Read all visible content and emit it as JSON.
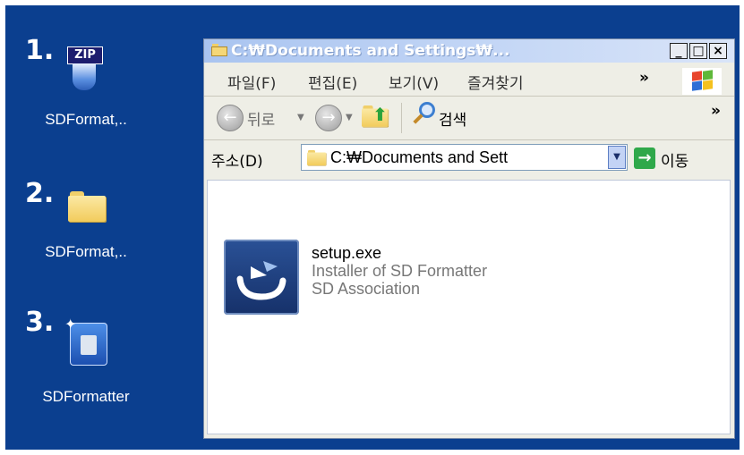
{
  "desktop": {
    "icons": [
      {
        "step": "1.",
        "label": "SDFormat,..",
        "icon": "zip-archive-icon"
      },
      {
        "step": "2.",
        "label": "SDFormat,..",
        "icon": "folder-icon"
      },
      {
        "step": "3.",
        "label": "SDFormatter",
        "icon": "sd-formatter-app-icon"
      }
    ]
  },
  "window": {
    "title": "C:₩Documents and Settings₩...",
    "controls": {
      "minimize": "_",
      "maximize": "□",
      "close": "×"
    },
    "menu": [
      "파일(F)",
      "편집(E)",
      "보기(V)",
      "즐겨찾기"
    ],
    "menu_overflow": "»",
    "toolbar": {
      "back": "뒤로",
      "search": "검색",
      "overflow": "»"
    },
    "address": {
      "label": "주소(D)",
      "value": "C:₩Documents and Sett",
      "go": "이동"
    },
    "file": {
      "name": "setup.exe",
      "description": "Installer of SD Formatter",
      "company": "SD Association"
    }
  }
}
